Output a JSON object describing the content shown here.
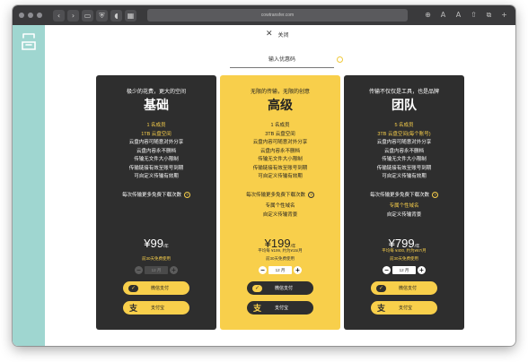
{
  "browser": {
    "url": "cowtransfer.com",
    "left_buttons": [
      "‹",
      "›",
      "▭",
      "⛨",
      "◖",
      "▦"
    ],
    "right_buttons": [
      "⊕",
      "A",
      "A",
      "⇧",
      "⧉",
      "+"
    ]
  },
  "dialog": {
    "close_label": "关闭",
    "coupon_placeholder": "输入优惠码"
  },
  "plans": [
    {
      "tagline": "极少的花费，更大的空间",
      "name": "基础",
      "features": [
        "1 名成员",
        "1TB 云盘空间",
        "云盘内容可随意对外分享",
        "云盘内容永不删档",
        "传输无文件大小限制",
        "传输链接有效至账号到期",
        "可自定义传输有效期"
      ],
      "highlight_count": 2,
      "extra": "每次传输更多免费下载次数",
      "extras_sub": [],
      "price": "¥99",
      "price_unit": "/年",
      "avg": "",
      "trial": "前30天免费使用",
      "months": "12 月",
      "wechat": "微信支付",
      "alipay": "支付宝"
    },
    {
      "tagline": "无限的传输，无限的创意",
      "name": "高级",
      "features": [
        "1 名成员",
        "3TB 云盘空间",
        "云盘内容可随意对外分享",
        "云盘内容永不删档",
        "传输无文件大小限制",
        "传输链接有效至账号到期",
        "可自定义传输有效期"
      ],
      "highlight_count": 2,
      "extra": "每次传输更多免费下载次数",
      "extras_sub": [
        "专属个性域名",
        "自定义传输背景"
      ],
      "price": "¥199",
      "price_unit": "/年",
      "avg": "平均每 ¥199, 约为¥15/月",
      "trial": "前30天免费使用",
      "months": "12 月",
      "wechat": "微信支付",
      "alipay": "支付宝"
    },
    {
      "tagline": "传输不仅仅是工具，也是品牌",
      "name": "团队",
      "features": [
        "5 名成员",
        "3TB 云盘空间(每个账号)",
        "云盘内容可随意对外分享",
        "云盘内容永不删档",
        "传输无文件大小限制",
        "传输链接有效至账号到期",
        "可自定义传输有效期"
      ],
      "highlight_count": 2,
      "extra": "每次传输更多免费下载次数",
      "extras_sub": [
        "专属个性域名",
        "自定义传输背景"
      ],
      "price": "¥799",
      "price_unit": "/年",
      "avg": "平均每 ¥400, 约为¥67/月",
      "trial": "前30天免费使用",
      "months": "12 月",
      "wechat": "微信支付",
      "alipay": "支付宝"
    }
  ],
  "colors": {
    "accent": "#f8cf4b",
    "card_dark": "#2e2e2e",
    "brand_strip": "#9fd6d0"
  }
}
